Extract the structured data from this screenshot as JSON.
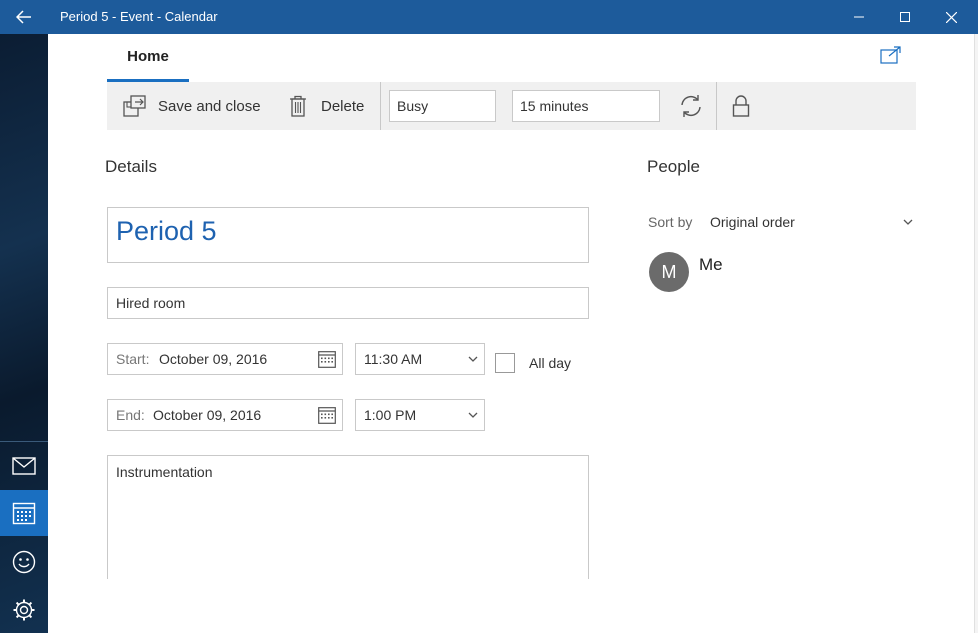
{
  "window": {
    "title": "Period 5 - Event - Calendar"
  },
  "ribbon": {
    "tab_home": "Home",
    "save_close": "Save and close",
    "delete": "Delete",
    "show_as": "Busy",
    "reminder": "15 minutes"
  },
  "details": {
    "heading": "Details",
    "event_title": "Period 5",
    "location": "Hired room",
    "start_label": "Start:",
    "start_date": "October 09, 2016",
    "start_time": "11:30 AM",
    "end_label": "End:",
    "end_date": "October 09, 2016",
    "end_time": "1:00 PM",
    "all_day": "All day",
    "notes": "Instrumentation"
  },
  "people": {
    "heading": "People",
    "sort_label": "Sort by",
    "sort_value": "Original order",
    "attendees": [
      {
        "initial": "M",
        "name": "Me"
      }
    ]
  },
  "colors": {
    "titlebar": "#1d5b9b",
    "accent": "#1a6fc1",
    "title_text": "#1e62b0"
  }
}
